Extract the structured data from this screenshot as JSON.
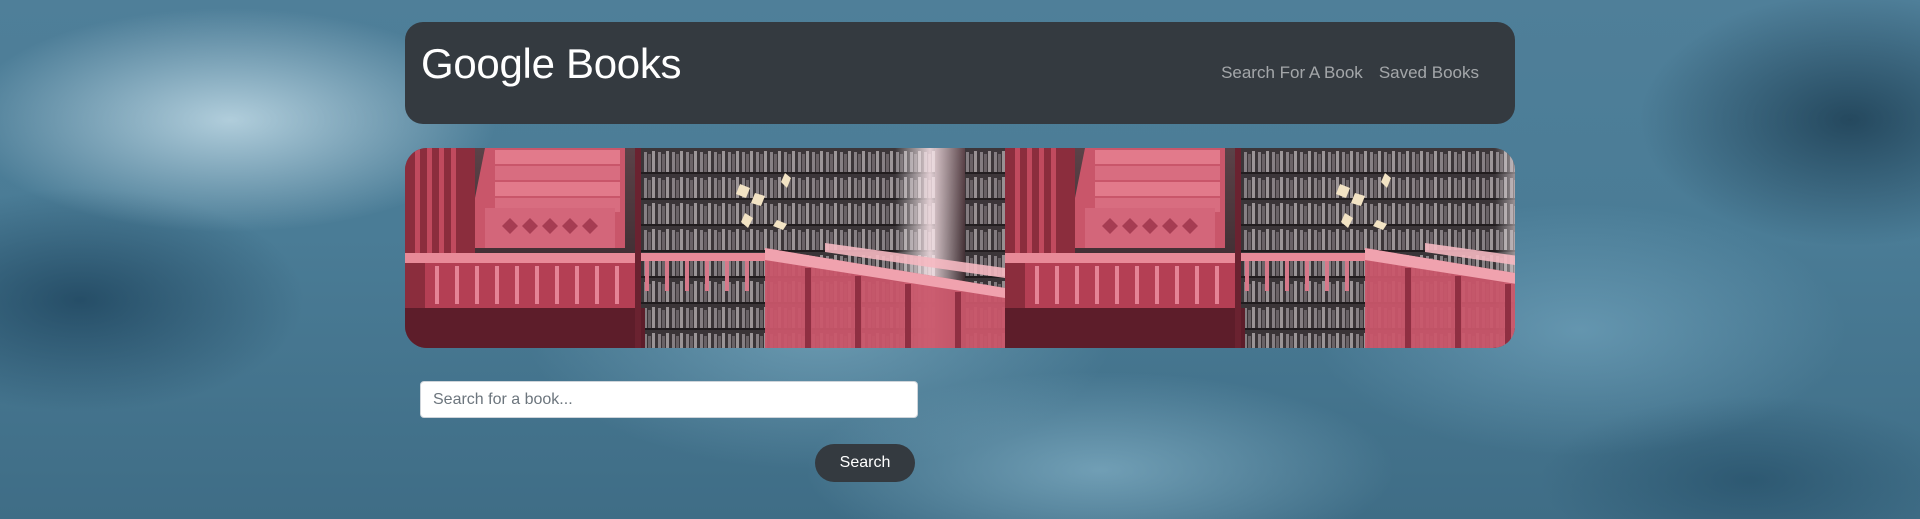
{
  "navbar": {
    "brand": "Google Books",
    "links": [
      {
        "label": "Search For A Book"
      },
      {
        "label": "Saved Books"
      }
    ]
  },
  "hero": {
    "image": "library-staircase-illustration"
  },
  "search": {
    "placeholder": "Search for a book...",
    "value": "",
    "button_label": "Search"
  },
  "colors": {
    "navbar_bg": "#343a40",
    "button_bg": "#343a40",
    "background": "#4a7c96"
  }
}
